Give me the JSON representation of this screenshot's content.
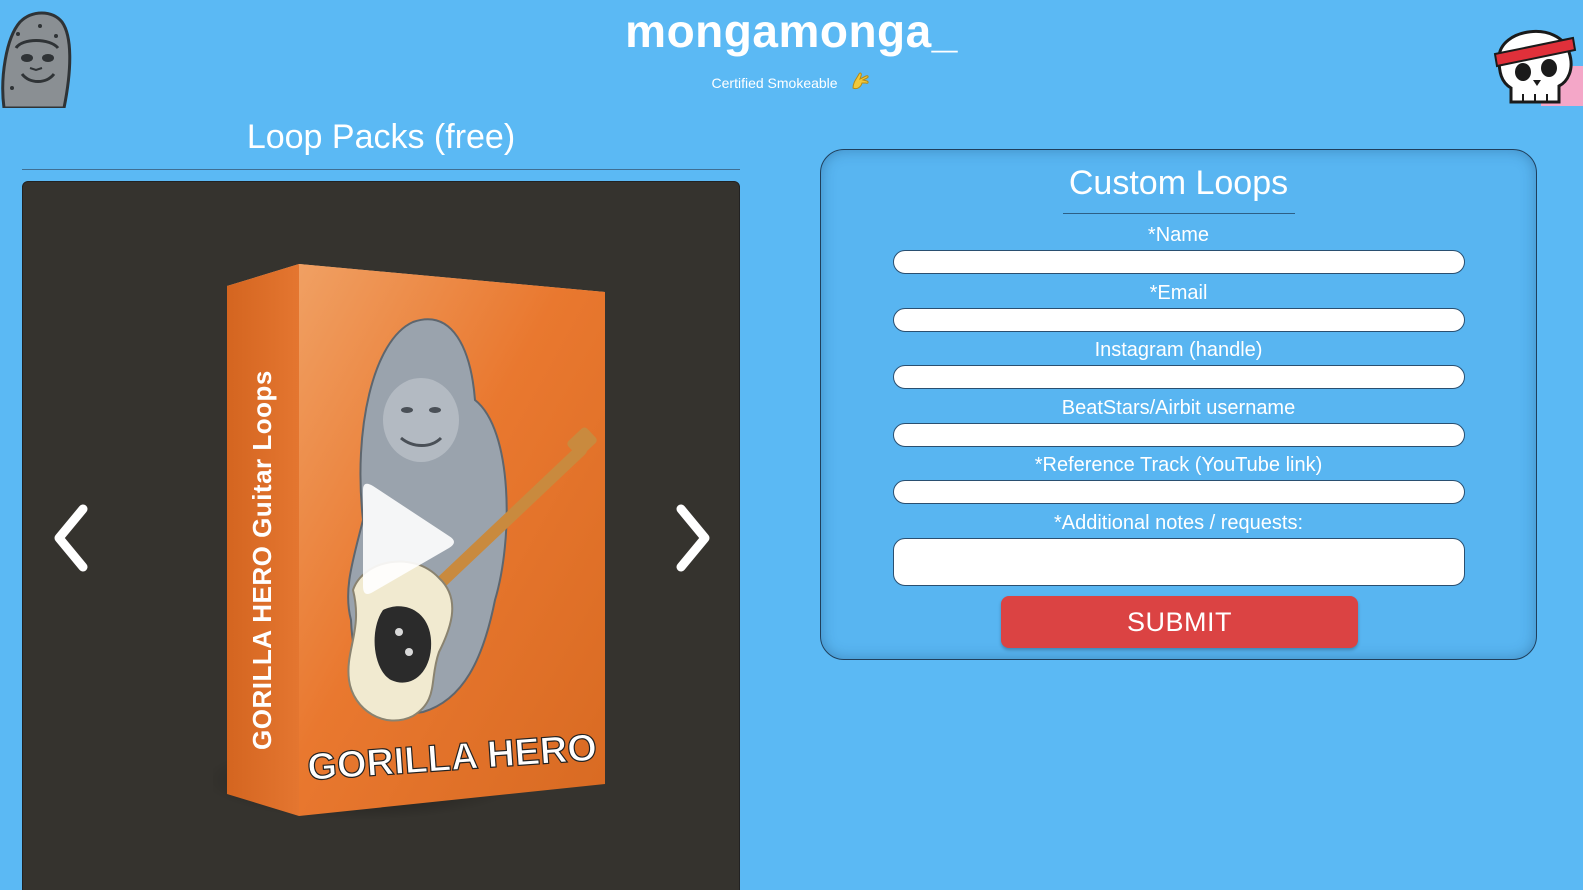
{
  "header": {
    "title": "mongamonga_",
    "tagline": "Certified Smokeable",
    "tagline_icon": "hand-icon"
  },
  "loop_packs": {
    "heading": "Loop Packs (free)",
    "carousel": {
      "prev_icon": "chevron-left-icon",
      "next_icon": "chevron-right-icon",
      "current_item": {
        "box_front_text": "GORILLA HERO",
        "box_spine_text": "GORILLA HERO Guitar Loops",
        "play_icon": "play-icon"
      }
    }
  },
  "custom_loops": {
    "heading": "Custom Loops",
    "fields": [
      {
        "label": "*Name",
        "value": "",
        "placeholder": ""
      },
      {
        "label": "*Email",
        "value": "",
        "placeholder": ""
      },
      {
        "label": "Instagram (handle)",
        "value": "",
        "placeholder": ""
      },
      {
        "label": "BeatStars/Airbit username",
        "value": "",
        "placeholder": ""
      },
      {
        "label": "*Reference Track (YouTube link)",
        "value": "",
        "placeholder": ""
      },
      {
        "label": "*Additional notes / requests:",
        "value": "",
        "placeholder": ""
      }
    ],
    "submit_label": "SUBMIT"
  },
  "colors": {
    "page_background": "#5bb9f4",
    "carousel_background": "#35332e",
    "box_orange": "#e9782f",
    "submit_red": "#db4343"
  }
}
